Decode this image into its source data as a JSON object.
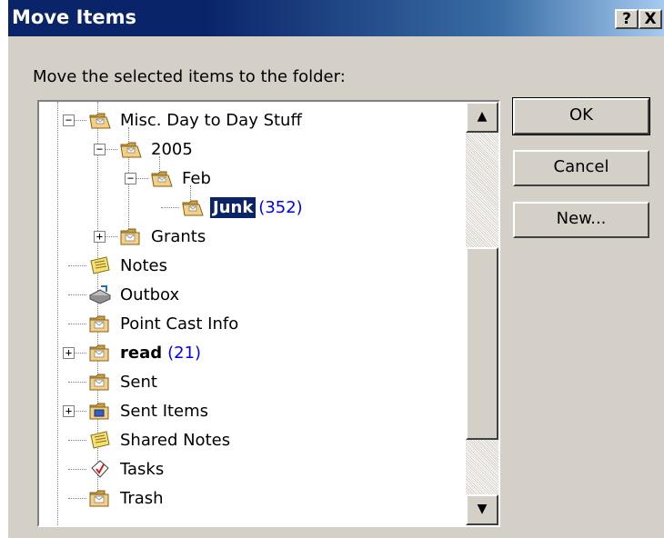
{
  "window": {
    "title": "Move Items",
    "help_label": "?",
    "close_label": "X"
  },
  "dialog": {
    "prompt": "Move the selected items to the folder:"
  },
  "buttons": {
    "ok": "OK",
    "cancel": "Cancel",
    "new": "New..."
  },
  "tree": [
    {
      "label": "Misc. Day to Day Stuff",
      "icon": "open-folder-icon",
      "expander": "minus"
    },
    {
      "label": "2005",
      "icon": "open-folder-icon",
      "expander": "minus"
    },
    {
      "label": "Feb",
      "icon": "open-folder-icon",
      "expander": "minus"
    },
    {
      "label": "Junk",
      "count": "(352)",
      "icon": "open-folder-icon",
      "selected": true
    },
    {
      "label": "Grants",
      "icon": "folder-icon",
      "expander": "plus"
    },
    {
      "label": "Notes",
      "icon": "notes-icon"
    },
    {
      "label": "Outbox",
      "icon": "outbox-icon"
    },
    {
      "label": "Point Cast Info",
      "icon": "folder-icon"
    },
    {
      "label": "read",
      "count": "(21)",
      "icon": "folder-icon",
      "expander": "plus",
      "bold": true
    },
    {
      "label": "Sent",
      "icon": "folder-icon"
    },
    {
      "label": "Sent Items",
      "icon": "sent-items-icon",
      "expander": "plus"
    },
    {
      "label": "Shared Notes",
      "icon": "notes-icon"
    },
    {
      "label": "Tasks",
      "icon": "tasks-icon"
    },
    {
      "label": "Trash",
      "icon": "folder-icon"
    }
  ],
  "colors": {
    "titlebar": "#0a246a",
    "selection": "#0a246a",
    "count": "#0000ff",
    "face": "#d4d0c8"
  }
}
